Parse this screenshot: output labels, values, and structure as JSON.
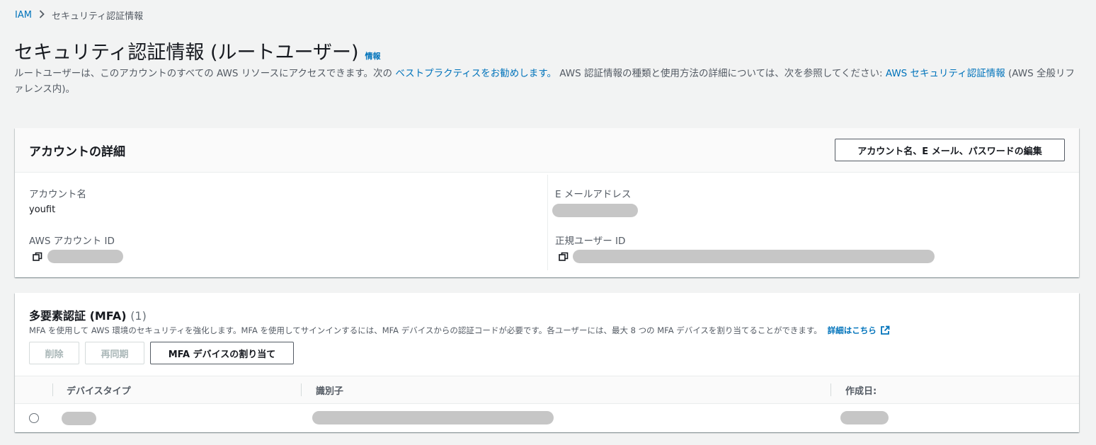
{
  "breadcrumb": {
    "root": "IAM",
    "current": "セキュリティ認証情報"
  },
  "page": {
    "title": "セキュリティ認証情報 (ルートユーザー)",
    "info": "情報",
    "desc_1": "ルートユーザーは、このアカウントのすべての AWS リソースにアクセスできます。次の ",
    "desc_link_1": "ベストプラクティスをお勧めします。",
    "desc_2": " AWS 認証情報の種類と使用方法の詳細については、次を参照してください: ",
    "desc_link_2": "AWS セキュリティ認証情報",
    "desc_3": " (AWS 全般リファレンス内)。"
  },
  "account": {
    "title": "アカウントの詳細",
    "edit_button": "アカウント名、E メール、パスワードの編集",
    "name_label": "アカウント名",
    "name_value": "youfit",
    "account_id_label": "AWS アカウント ID",
    "email_label": "E メールアドレス",
    "canonical_id_label": "正規ユーザー ID"
  },
  "mfa": {
    "title": "多要素認証 (MFA)",
    "count": "(1)",
    "desc": "MFA を使用して AWS 環境のセキュリティを強化します。MFA を使用してサインインするには、MFA デバイスからの認証コードが必要です。各ユーザーには、最大 8 つの MFA デバイスを割り当てることができます。",
    "learn_more": "詳細はこちら",
    "delete_button": "削除",
    "resync_button": "再同期",
    "assign_button": "MFA デバイスの割り当て",
    "columns": [
      "デバイスタイプ",
      "識別子",
      "作成日:"
    ]
  }
}
